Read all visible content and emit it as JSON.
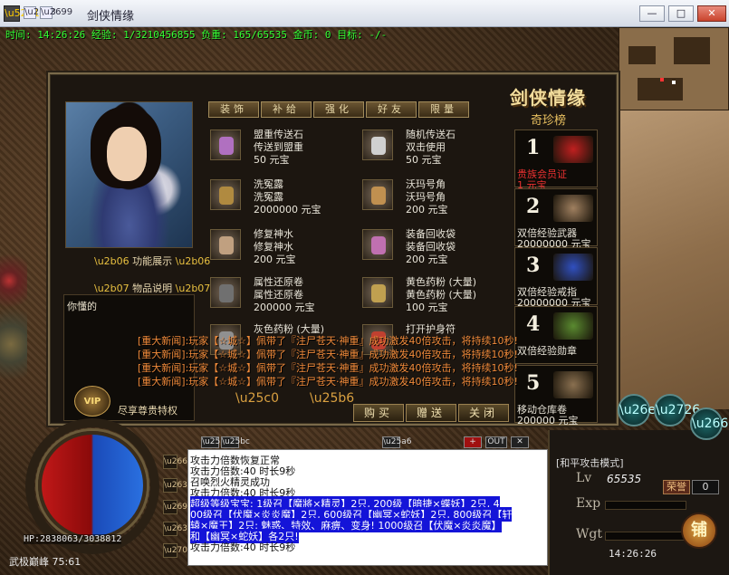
{
  "window": {
    "title": "剑侠情缘",
    "controls": {
      "minimize": "—",
      "maximize": "□",
      "close": "✕"
    }
  },
  "status_line": "时间: 14:26:26 经验: 1/3210456855 负重: 165/65535 金币: 0 目标: -/-",
  "shop": {
    "title": "剑侠情缘",
    "subtitle": "奇珍榜",
    "tabs": [
      "装饰",
      "补给",
      "强化",
      "好友",
      "限量"
    ],
    "func_label": "功能展示",
    "desc_label": "物品说明",
    "desc_text": "你懂的",
    "vip_badge": "VIP",
    "vip_label": "尽享尊贵特权",
    "items": [
      {
        "name": "盟重传送石",
        "desc": "传送到盟重",
        "price": "50 元宝",
        "icon": "stone-icon",
        "color": "#b070c0"
      },
      {
        "name": "随机传送石",
        "desc": "双击使用",
        "price": "50 元宝",
        "icon": "stone-icon",
        "color": "#d0d0d0"
      },
      {
        "name": "洗冤露",
        "desc": "洗冤露",
        "price": "2000000 元宝",
        "icon": "potion-icon",
        "color": "#b08a40"
      },
      {
        "name": "沃玛号角",
        "desc": "沃玛号角",
        "price": "200 元宝",
        "icon": "horn-icon",
        "color": "#c09050"
      },
      {
        "name": "修复神水",
        "desc": "修复神水",
        "price": "200 元宝",
        "icon": "bottle-icon",
        "color": "#c0a080"
      },
      {
        "name": "装备回收袋",
        "desc": "装备回收袋",
        "price": "200 元宝",
        "icon": "bag-icon",
        "color": "#c070b0"
      },
      {
        "name": "属性还原卷",
        "desc": "属性还原卷",
        "price": "200000 元宝",
        "icon": "scroll-icon",
        "color": "#707070"
      },
      {
        "name": "黄色药粉 (大量)",
        "desc": "黄色药粉 (大量)",
        "price": "100 元宝",
        "icon": "powder-icon",
        "color": "#c0a050"
      },
      {
        "name": "灰色药粉 (大量)",
        "desc": "",
        "price": "",
        "icon": "powder-icon",
        "color": "#909090"
      },
      {
        "name": "打开护身符",
        "desc": "",
        "price": "",
        "icon": "charm-icon",
        "color": "#c04030"
      }
    ],
    "ranks": [
      {
        "num": "1",
        "name": "贵族会员证",
        "price": "1 元宝",
        "name_color": "#e83030",
        "icon": "vip-card-icon",
        "color": "#c02020"
      },
      {
        "num": "2",
        "name": "双倍经验武器",
        "price": "20000000 元宝",
        "name_color": "#e8e4d8",
        "icon": "sword-icon",
        "color": "#a08060"
      },
      {
        "num": "3",
        "name": "双倍经验戒指",
        "price": "20000000 元宝",
        "name_color": "#e8e4d8",
        "icon": "ring-icon",
        "color": "#3050c0"
      },
      {
        "num": "4",
        "name": "双倍经验勋章",
        "price": "",
        "name_color": "#e8e4d8",
        "icon": "medal-icon",
        "color": "#5a8a30"
      },
      {
        "num": "5",
        "name": "移动仓库卷",
        "price": "200000 元宝",
        "name_color": "#e8e4d8",
        "icon": "scroll-icon",
        "color": "#8a7050"
      }
    ],
    "buttons": {
      "buy": "购买",
      "gift": "赠送",
      "close": "关闭"
    }
  },
  "news": [
    "[重大新闻]:玩家【☆城☆】佩带了『注尸苍天·神重』成功激发40倍攻击，将持续10秒!",
    "[重大新闻]:玩家【☆城☆】佩带了『注尸苍天·神重』成功激发40倍攻击，将持续10秒!",
    "[重大新闻]:玩家【☆城☆】佩带了『注尸苍天·神重』成功激发40倍攻击，将持续10秒!",
    "[重大新闻]:玩家【☆城☆】佩带了『注尸苍天·神重』成功激发40倍攻击，将持续10秒!"
  ],
  "chat": {
    "tools": {
      "out": "OUT",
      "close": "✕"
    },
    "lines": [
      {
        "text": "攻击力倍数恢复正常",
        "hl": false
      },
      {
        "text": "攻击力倍数:40 时长9秒",
        "hl": false
      },
      {
        "text": "召唤烈火精灵成功",
        "hl": false
      },
      {
        "text": "攻击力倍数:40 时长9秒",
        "hl": false
      },
      {
        "text": "超级等级宝宝: 1级召【魔將×精灵】2只, 200级【暗捷×蝶妖】2只, 4",
        "hl": true
      },
      {
        "text": "00级召【伏魔×炎炎魔】2只, 600级召【幽冥×蛇妖】2只, 800级召【轩",
        "hl": true
      },
      {
        "text": "辕×魔王】2只: 魅惑、特效、麻痹、变身! 1000级召【伏魔×炎炎魔】",
        "hl": true
      },
      {
        "text": "和【幽冥×蛇妖】各2只!",
        "hl": true
      },
      {
        "text": "攻击力倍数:40 时长9秒",
        "hl": false
      }
    ]
  },
  "player": {
    "hp": "HP:2838063/3038812",
    "location": "武极巅峰 75:61",
    "attack_mode": "[和平攻击模式]",
    "lv_label": "Lv",
    "level": "65535",
    "exp_label": "Exp",
    "wgt_label": "Wgt",
    "honor_label": "荣誉",
    "honor": "0",
    "shop_btn": "铺",
    "clock": "14:26:26"
  }
}
